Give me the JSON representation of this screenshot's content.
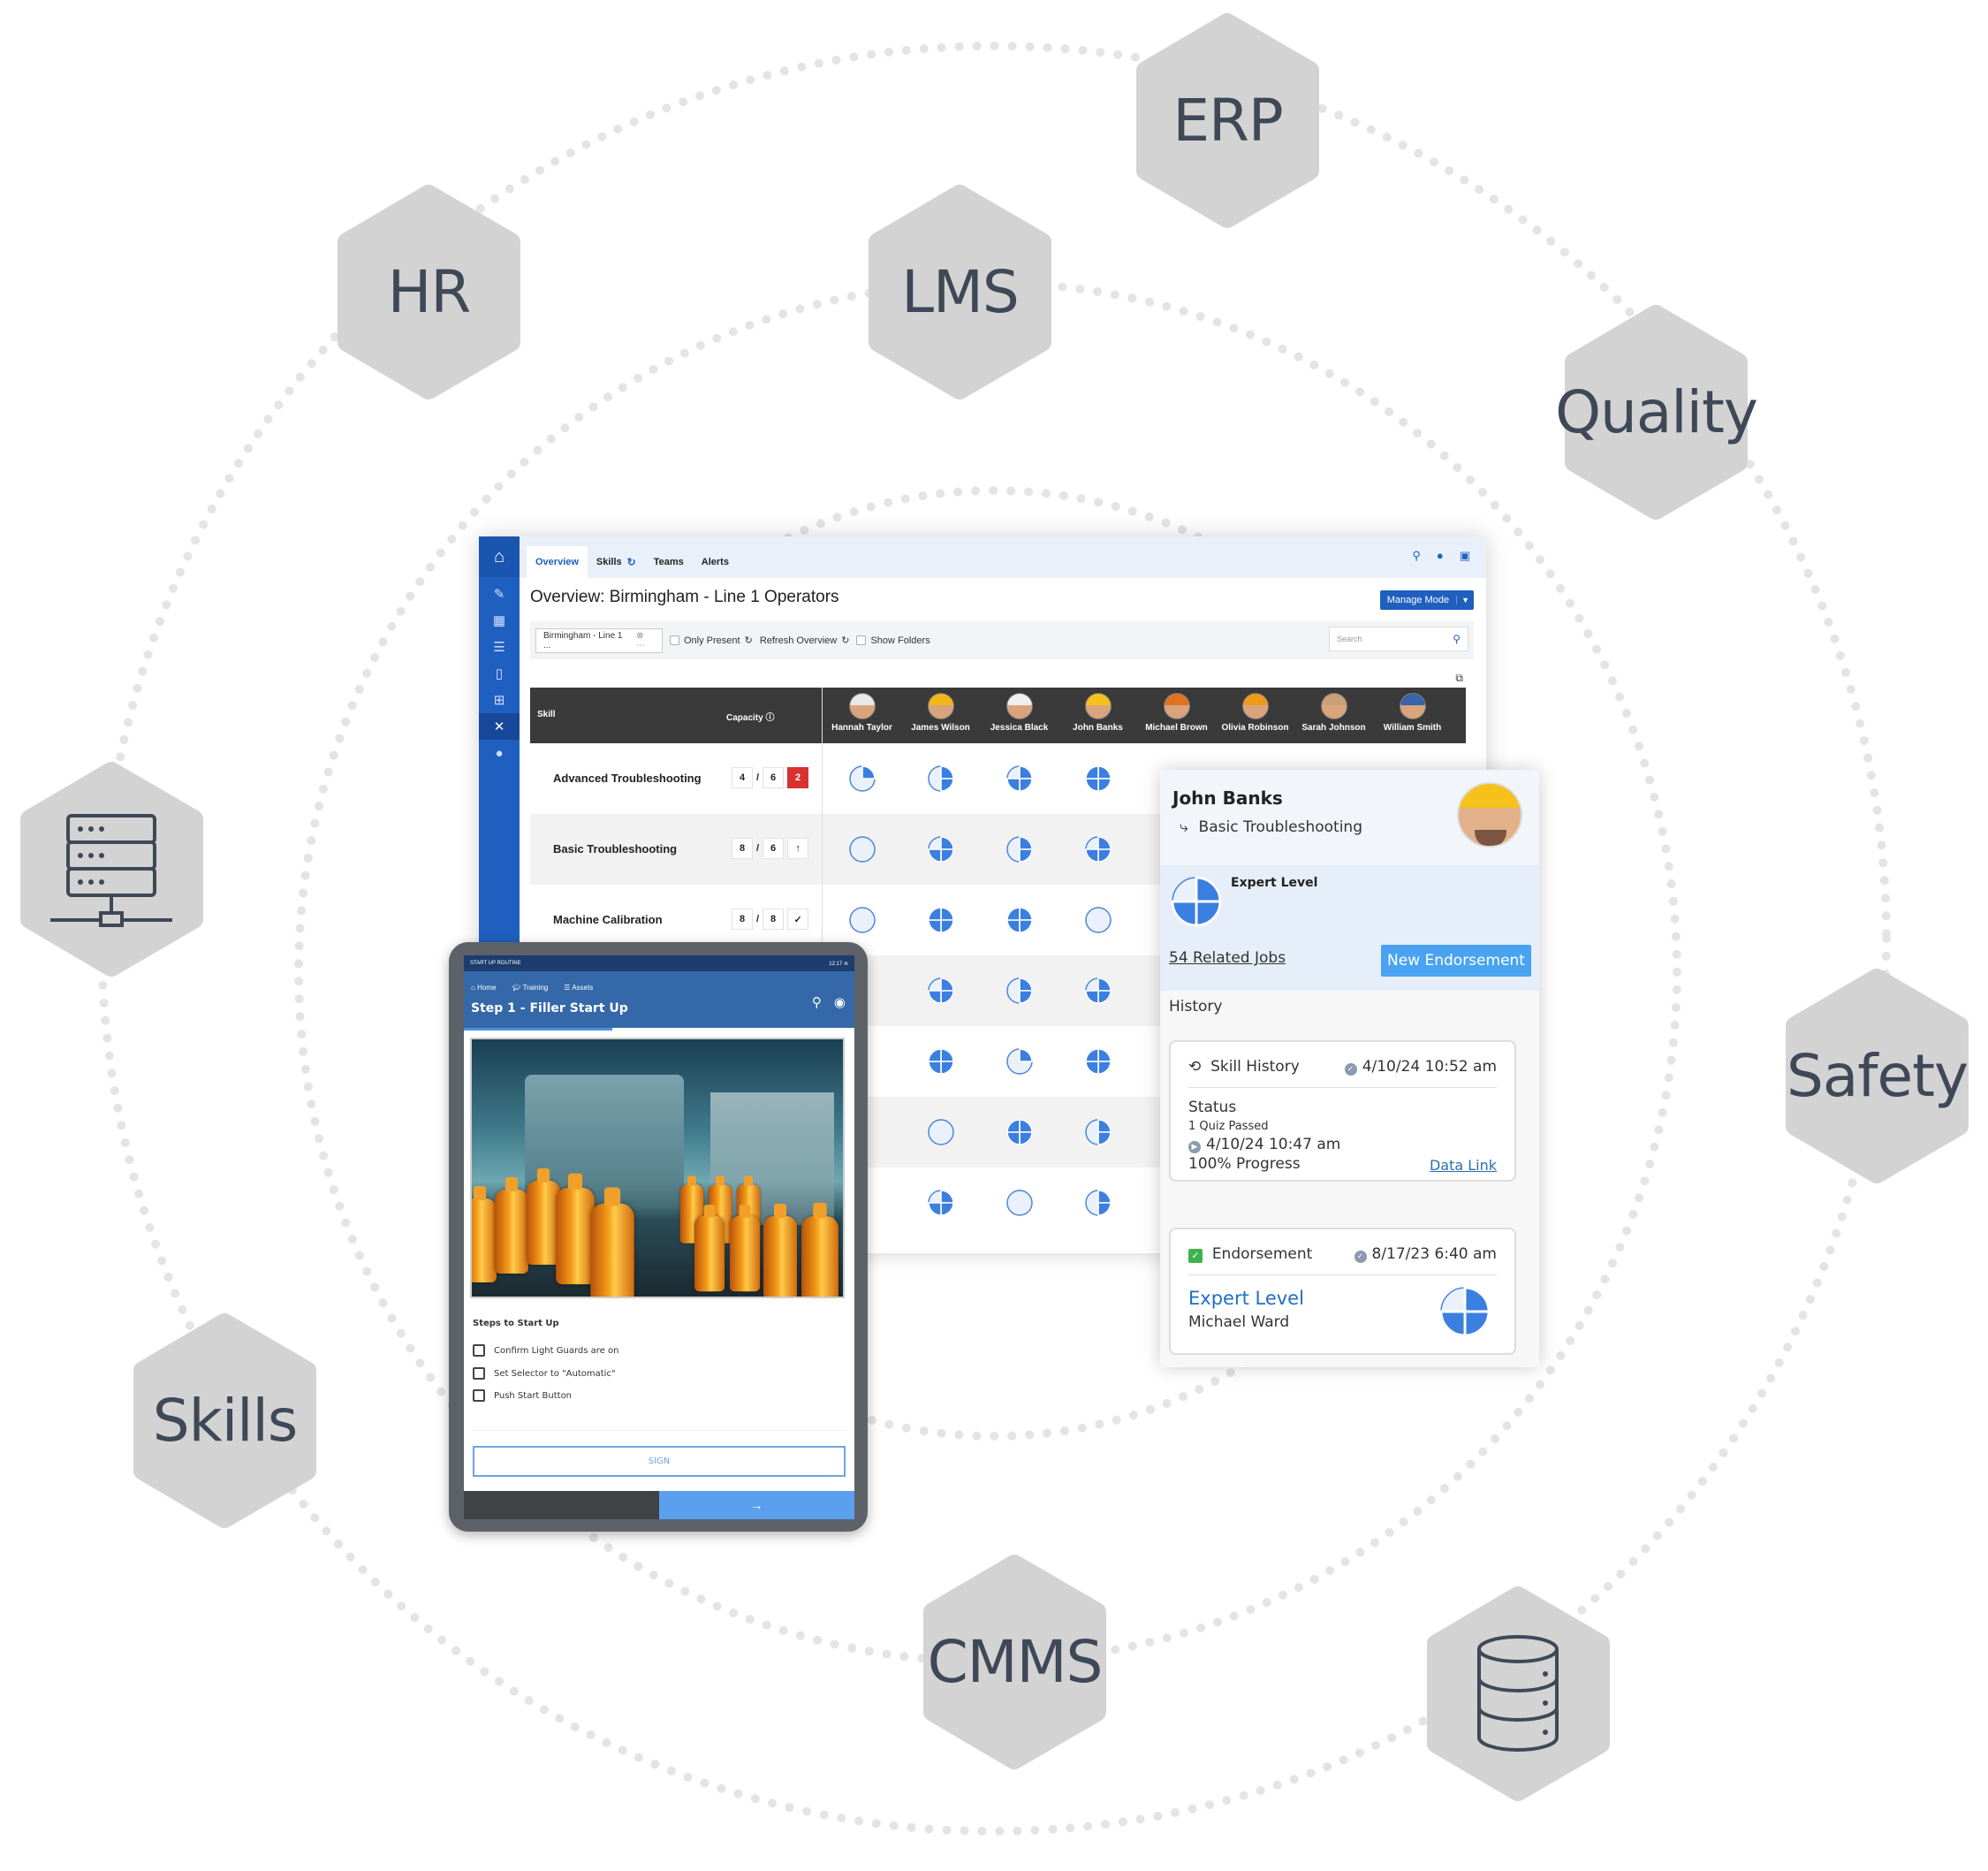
{
  "hexagons": [
    {
      "label": "ERP"
    },
    {
      "label": "HR"
    },
    {
      "label": "LMS"
    },
    {
      "label": "Quality"
    },
    {
      "label": "",
      "icon": "server-icon"
    },
    {
      "label": "Safety"
    },
    {
      "label": "Skills"
    },
    {
      "label": "CMMS"
    },
    {
      "label": "",
      "icon": "database-icon"
    }
  ],
  "app": {
    "tabs": [
      {
        "label": "Overview",
        "active": true
      },
      {
        "label": "Skills"
      },
      {
        "label": "Teams"
      },
      {
        "label": "Alerts"
      }
    ],
    "title": "Overview: Birmingham - Line 1 Operators",
    "manage_mode": "Manage Mode",
    "filter": {
      "select_value": "Birmingham - Line 1 ...",
      "only_present": "Only Present",
      "refresh": "Refresh Overview",
      "show_folders": "Show Folders",
      "search_placeholder": "Search"
    },
    "table": {
      "skill_header": "Skill",
      "capacity_header": "Capacity",
      "people": [
        "Hannah Taylor",
        "James Wilson",
        "Jessica Black",
        "John Banks",
        "Michael Brown",
        "Olivia Robinson",
        "Sarah Johnson",
        "William Smith"
      ],
      "helmet_colors": [
        "#e8e8e8",
        "#f2b619",
        "#f0f0f0",
        "#f5c11a",
        "#e0731e",
        "#f09a1a",
        "#c9a07a",
        "#3a64a8"
      ],
      "rows": [
        {
          "skill": "Advanced Troubleshooting",
          "current": "4",
          "required": "6",
          "status": "2",
          "status_type": "shortfall",
          "levels": [
            1,
            2,
            3,
            4
          ]
        },
        {
          "skill": "Basic Troubleshooting",
          "current": "8",
          "required": "6",
          "status": "",
          "status_type": "arrow-up-icon",
          "levels": [
            0,
            3,
            2,
            3
          ]
        },
        {
          "skill": "Machine Calibration",
          "current": "8",
          "required": "8",
          "status": "",
          "status_type": "check-icon",
          "levels": [
            0,
            4,
            4,
            0
          ]
        },
        {
          "skill": "",
          "levels": [
            null,
            3,
            2,
            3
          ]
        },
        {
          "skill": "",
          "levels": [
            null,
            4,
            1,
            4
          ]
        },
        {
          "skill": "",
          "levels": [
            null,
            0,
            4,
            2
          ]
        },
        {
          "skill": "",
          "levels": [
            null,
            3,
            0,
            2
          ]
        }
      ]
    }
  },
  "panel": {
    "name": "John Banks",
    "skill": "Basic Troubleshooting",
    "level_label": "Expert Level",
    "level": 3,
    "related_jobs": "54 Related Jobs",
    "new_endorsement": "New Endorsement",
    "history_label": "History",
    "skill_history": {
      "title": "Skill History",
      "date": "4/10/24 10:52 am",
      "status_label": "Status",
      "quiz": "1 Quiz Passed",
      "quiz_date": "4/10/24 10:47 am",
      "progress": "100% Progress",
      "link": "Data Link"
    },
    "endorsement": {
      "title": "Endorsement",
      "date": "8/17/23 6:40 am",
      "level": "Expert Level",
      "level_value": 3,
      "by": "Michael Ward"
    }
  },
  "tablet": {
    "status_title": "START UP ROUTINE",
    "time": "12:17",
    "nav": [
      "Home",
      "Training",
      "Assets"
    ],
    "step_title": "Step 1 - Filler Start Up",
    "steps_heading": "Steps to Start Up",
    "steps": [
      "Confirm Light Guards are on",
      "Set Selector to \"Automatic\"",
      "Push Start Button"
    ],
    "sign": "SIGN"
  },
  "colors": {
    "brand": "#1f5fbf",
    "pie": "#3b7fe0",
    "shortfall": "#d93030",
    "button": "#4aa3f0"
  }
}
